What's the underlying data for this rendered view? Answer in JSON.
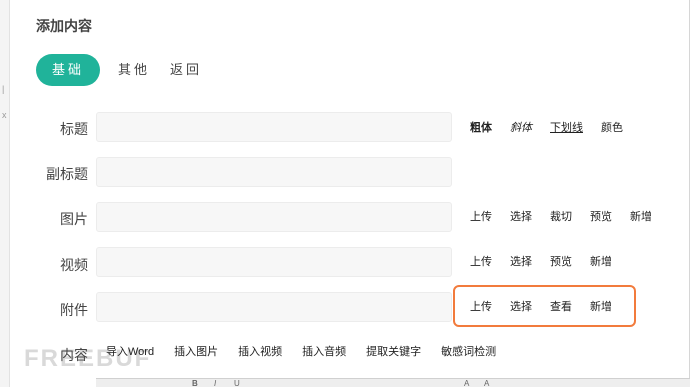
{
  "page": {
    "title": "添加内容"
  },
  "tabs": [
    {
      "label": "基础",
      "active": true
    },
    {
      "label": "其他",
      "active": false
    },
    {
      "label": "返回",
      "active": false
    }
  ],
  "rows": {
    "title": {
      "label": "标题",
      "actions": [
        "粗体",
        "斜体",
        "下划线",
        "颜色"
      ]
    },
    "subtitle": {
      "label": "副标题"
    },
    "image": {
      "label": "图片",
      "actions": [
        "上传",
        "选择",
        "裁切",
        "预览",
        "新增"
      ]
    },
    "video": {
      "label": "视频",
      "actions": [
        "上传",
        "选择",
        "预览",
        "新增"
      ]
    },
    "attachment": {
      "label": "附件",
      "actions": [
        "上传",
        "选择",
        "查看",
        "新增"
      ]
    },
    "content": {
      "label": "内容",
      "actions": [
        "导入Word",
        "插入图片",
        "插入视频",
        "插入音频",
        "提取关键字",
        "敏感词检测"
      ]
    }
  },
  "editor_toolbar": {
    "glyphs": [
      "B",
      "I",
      "U",
      "A",
      "A"
    ]
  },
  "watermark": "FREEBUF",
  "colors": {
    "accent": "#20b39a",
    "highlight": "#f27b3c"
  }
}
